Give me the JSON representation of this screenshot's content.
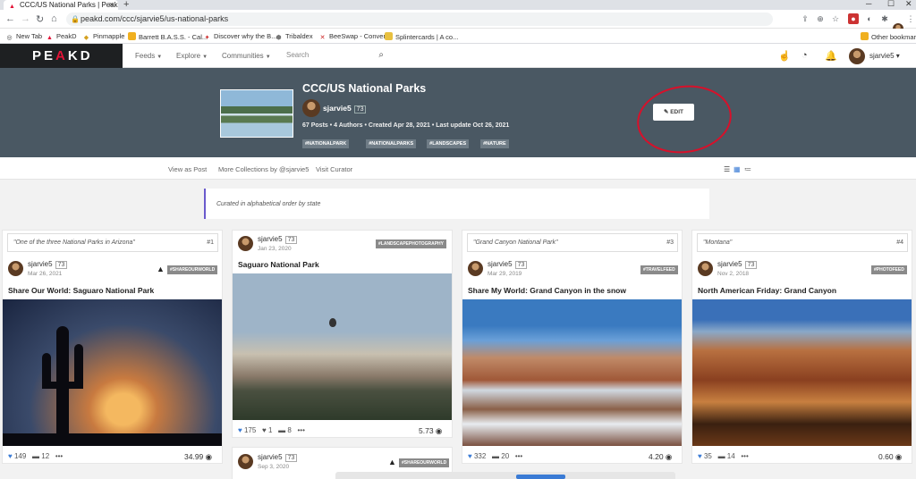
{
  "browser": {
    "tab_title": "CCC/US National Parks | PeakD",
    "url": "peakd.com/ccc/sjarvie5/us-national-parks",
    "bookmarks": [
      "New Tab",
      "PeakD",
      "Pinmapple",
      "Barrett B.A.S.S. - Cal...",
      "Discover why the B...",
      "Tribaldex",
      "BeeSwap - Convert",
      "Splintercards | A co..."
    ],
    "other_bookmarks": "Other bookmarks"
  },
  "header": {
    "logo_left": "PE",
    "logo_mid": "A",
    "logo_right": "KD",
    "nav": [
      "Feeds",
      "Explore",
      "Communities"
    ],
    "search_placeholder": "Search",
    "username": "sjarvie5"
  },
  "collection": {
    "title": "CCC/US National Parks",
    "author": "sjarvie5",
    "reputation": "73",
    "stats": "67 Posts  •  4 Authors  •  Created Apr 28, 2021  •  Last update Oct 26, 2021",
    "tags": [
      "#NATIONALPARK",
      "#NATIONALPARKS",
      "#LANDSCAPES",
      "#NATURE"
    ],
    "edit_label": "EDIT"
  },
  "subnav": {
    "view_as_post": "View as Post",
    "more_collections": "More Collections by @sjarvie5",
    "visit_curator": "Visit Curator"
  },
  "curated_note": "Curated in alphabetical order by state",
  "cards": [
    {
      "quote": "\"One of the three National Parks in Arizona\"",
      "num": "#1",
      "author": "sjarvie5",
      "rep": "73",
      "date": "Mar 26, 2021",
      "tag": "#SHAREOURWORLD",
      "title": "Share Our World: Saguaro National Park",
      "likes": "149",
      "comments": "12",
      "value": "34.99"
    },
    {
      "author": "sjarvie5",
      "rep": "73",
      "date": "Jan 23, 2020",
      "tag": "#LANDSCAPEPHOTOGRAPHY",
      "title": "Saguaro National Park",
      "likes": "175",
      "reblogs": "1",
      "comments": "8",
      "value": "5.73"
    },
    {
      "quote": "\"Grand Canyon National Park\"",
      "num": "#3",
      "author": "sjarvie5",
      "rep": "73",
      "date": "Mar 29, 2019",
      "tag": "#TRAVELFEED",
      "title": "Share My World: Grand Canyon in the snow",
      "likes": "332",
      "comments": "20",
      "value": "4.20"
    },
    {
      "quote": "\"Montana\"",
      "num": "#4",
      "author": "sjarvie5",
      "rep": "73",
      "date": "Nov 2, 2018",
      "tag": "#PHOTOFEED",
      "title": "North American Friday: Grand Canyon",
      "likes": "35",
      "comments": "14",
      "value": "0.60"
    },
    {
      "author": "sjarvie5",
      "rep": "73",
      "date": "Sep 3, 2020",
      "tag": "#SHAREOURWORLD"
    }
  ],
  "icons": {
    "like": "heart-icon",
    "comment": "comment-icon",
    "more": "more-icon",
    "hive": "hive-icon"
  }
}
